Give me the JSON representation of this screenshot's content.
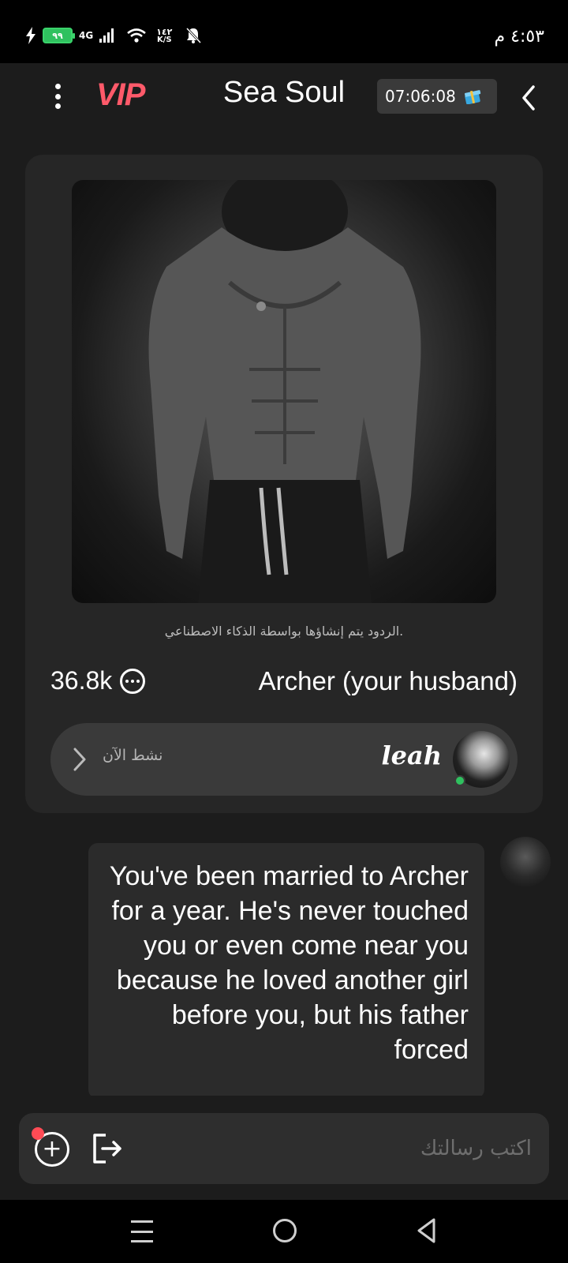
{
  "status_bar": {
    "battery": "٩٩",
    "network": "4G",
    "speed_value": "١٤٢",
    "speed_unit": "K/S",
    "time": "٤:٥٣ م"
  },
  "header": {
    "badge": "VIP",
    "title": "Sea Soul",
    "timer": "07:06:08"
  },
  "profile": {
    "disclaimer": "الردود يتم إنشاؤها بواسطة الذكاء الاصطناعي.",
    "chat_count": "36.8k",
    "character_name": "Archer (your husband)",
    "creator": {
      "name": "leah",
      "status": "نشط الآن"
    }
  },
  "message": {
    "text": "You've been married to Archer for a year. He's never touched you or even come near you because he loved another girl before you, but his father forced"
  },
  "input": {
    "placeholder": "اكتب رسالتك"
  },
  "colors": {
    "vip": "#ff5a6a",
    "background": "#1c1c1c",
    "card": "#262626",
    "online": "#2fc15f"
  }
}
